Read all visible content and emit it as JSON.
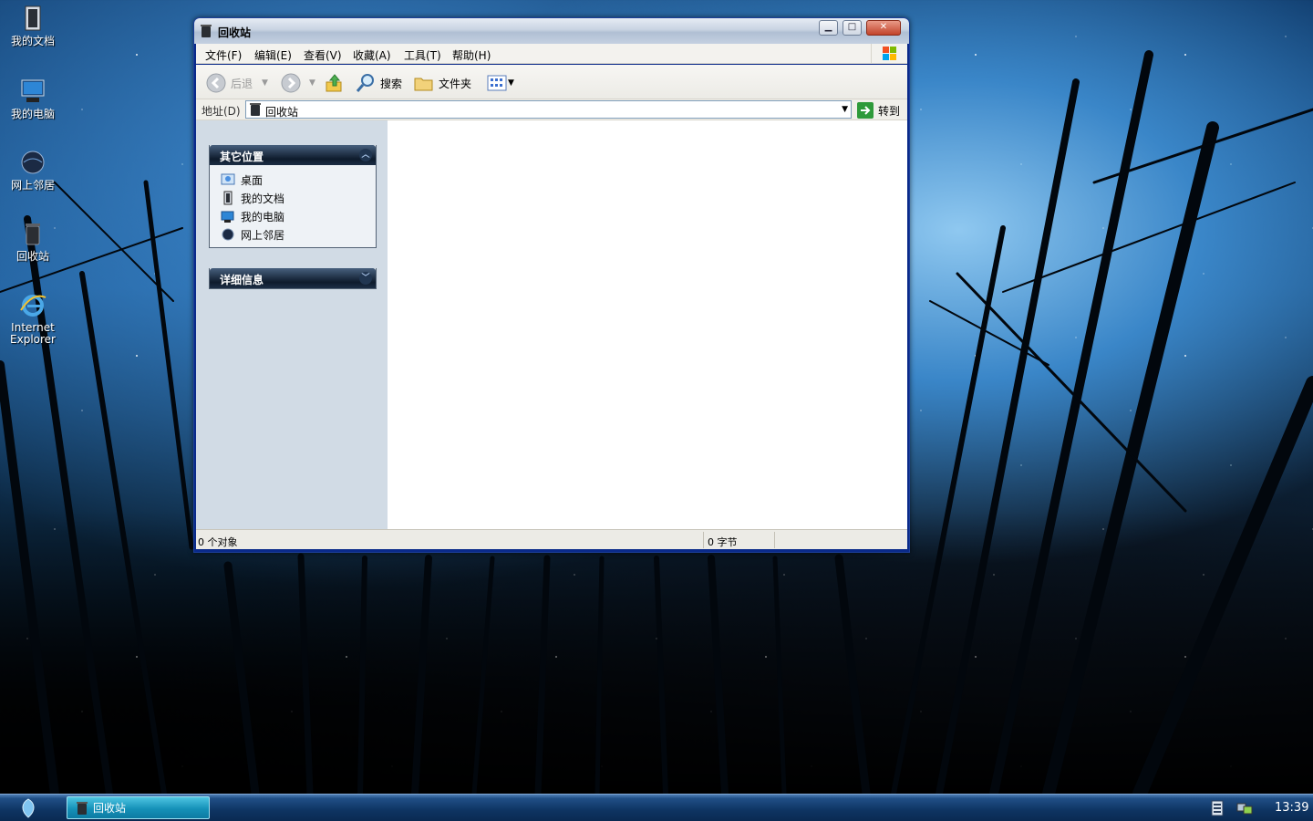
{
  "desktop": {
    "icons": [
      {
        "label": "我的文档",
        "icon": "my-documents-icon"
      },
      {
        "label": "我的电脑",
        "icon": "my-computer-icon"
      },
      {
        "label": "网上邻居",
        "icon": "network-places-icon"
      },
      {
        "label": "回收站",
        "icon": "recycle-bin-icon"
      },
      {
        "label": "Internet\nExplorer",
        "label_line1": "Internet",
        "label_line2": "Explorer",
        "icon": "internet-explorer-icon"
      }
    ]
  },
  "window": {
    "title": "回收站",
    "menu": [
      "文件(F)",
      "编辑(E)",
      "查看(V)",
      "收藏(A)",
      "工具(T)",
      "帮助(H)"
    ],
    "toolbar": {
      "back_label": "后退",
      "search_label": "搜索",
      "folders_label": "文件夹"
    },
    "address": {
      "label": "地址(D)",
      "value": "回收站",
      "go_label": "转到"
    },
    "tasks": {
      "other_places": {
        "title": "其它位置",
        "links": [
          {
            "label": "桌面",
            "icon": "desktop-icon"
          },
          {
            "label": "我的文档",
            "icon": "my-documents-icon"
          },
          {
            "label": "我的电脑",
            "icon": "my-computer-icon"
          },
          {
            "label": "网上邻居",
            "icon": "network-places-icon"
          }
        ]
      },
      "details": {
        "title": "详细信息"
      }
    },
    "status": {
      "objects": "0 个对象",
      "size": "0 字节"
    }
  },
  "taskbar": {
    "active_task": "回收站",
    "clock": "13:39"
  }
}
